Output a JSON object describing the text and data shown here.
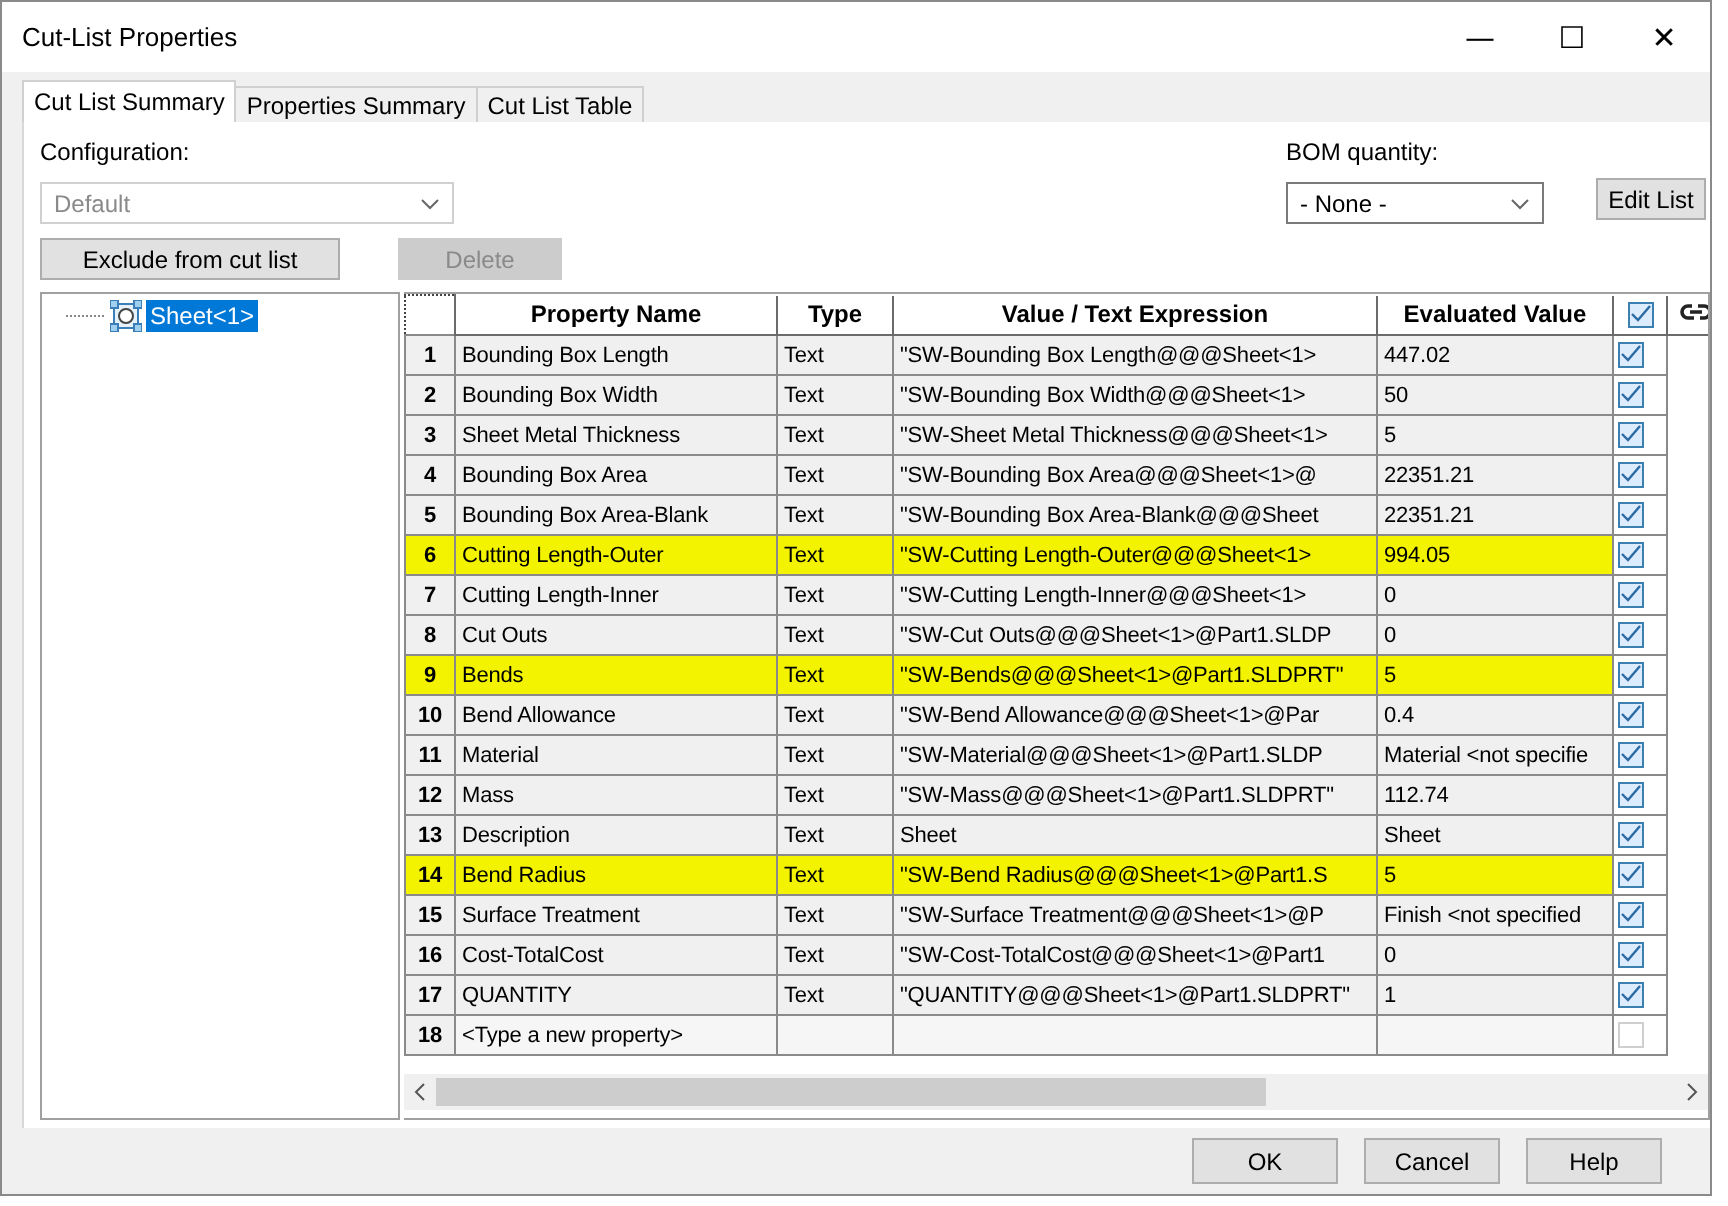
{
  "window": {
    "title": "Cut-List Properties",
    "controls": [
      "—",
      "☐",
      "✕"
    ]
  },
  "tabs": [
    {
      "label": "Cut List Summary",
      "selected": true
    },
    {
      "label": "Properties Summary",
      "selected": false
    },
    {
      "label": "Cut List Table",
      "selected": false
    }
  ],
  "configuration": {
    "label": "Configuration:",
    "value": "Default",
    "disabled": true
  },
  "bom_quantity": {
    "label": "BOM quantity:",
    "value": "- None -"
  },
  "buttons": {
    "exclude": {
      "label": "Exclude from cut list",
      "disabled": false
    },
    "delete": {
      "label": "Delete",
      "disabled": true
    },
    "edit_list": {
      "label": "Edit List",
      "disabled": false
    }
  },
  "tree": {
    "items": [
      {
        "label": "Sheet<1>",
        "selected": true
      }
    ]
  },
  "table": {
    "columns": [
      "Property Name",
      "Type",
      "Value / Text Expression",
      "Evaluated Value"
    ],
    "include_all": true,
    "rows": [
      {
        "number": "1",
        "name": "Bounding Box Length",
        "type": "Text",
        "value": "\"SW-Bounding Box Length@@@Sheet<1>",
        "evaluated": "447.02",
        "included": true,
        "highlighted": false
      },
      {
        "number": "2",
        "name": "Bounding Box Width",
        "type": "Text",
        "value": "\"SW-Bounding Box Width@@@Sheet<1>",
        "evaluated": "50",
        "included": true,
        "highlighted": false
      },
      {
        "number": "3",
        "name": "Sheet Metal Thickness",
        "type": "Text",
        "value": "\"SW-Sheet Metal Thickness@@@Sheet<1>",
        "evaluated": "5",
        "included": true,
        "highlighted": false
      },
      {
        "number": "4",
        "name": "Bounding Box Area",
        "type": "Text",
        "value": "\"SW-Bounding Box Area@@@Sheet<1>@",
        "evaluated": "22351.21",
        "included": true,
        "highlighted": false
      },
      {
        "number": "5",
        "name": "Bounding Box Area-Blank",
        "type": "Text",
        "value": "\"SW-Bounding Box Area-Blank@@@Sheet",
        "evaluated": "22351.21",
        "included": true,
        "highlighted": false
      },
      {
        "number": "6",
        "name": "Cutting Length-Outer",
        "type": "Text",
        "value": "\"SW-Cutting Length-Outer@@@Sheet<1>",
        "evaluated": "994.05",
        "included": true,
        "highlighted": true
      },
      {
        "number": "7",
        "name": "Cutting Length-Inner",
        "type": "Text",
        "value": "\"SW-Cutting Length-Inner@@@Sheet<1>",
        "evaluated": "0",
        "included": true,
        "highlighted": false
      },
      {
        "number": "8",
        "name": "Cut Outs",
        "type": "Text",
        "value": "\"SW-Cut Outs@@@Sheet<1>@Part1.SLDP",
        "evaluated": "0",
        "included": true,
        "highlighted": false
      },
      {
        "number": "9",
        "name": "Bends",
        "type": "Text",
        "value": "\"SW-Bends@@@Sheet<1>@Part1.SLDPRT\"",
        "evaluated": "5",
        "included": true,
        "highlighted": true
      },
      {
        "number": "10",
        "name": "Bend Allowance",
        "type": "Text",
        "value": "\"SW-Bend Allowance@@@Sheet<1>@Par",
        "evaluated": "0.4",
        "included": true,
        "highlighted": false
      },
      {
        "number": "11",
        "name": "Material",
        "type": "Text",
        "value": "\"SW-Material@@@Sheet<1>@Part1.SLDP",
        "evaluated": "Material <not specifie",
        "included": true,
        "highlighted": false
      },
      {
        "number": "12",
        "name": "Mass",
        "type": "Text",
        "value": "\"SW-Mass@@@Sheet<1>@Part1.SLDPRT\"",
        "evaluated": "112.74",
        "included": true,
        "highlighted": false
      },
      {
        "number": "13",
        "name": "Description",
        "type": "Text",
        "value": "Sheet",
        "evaluated": "Sheet",
        "included": true,
        "highlighted": false
      },
      {
        "number": "14",
        "name": "Bend Radius",
        "type": "Text",
        "value": "\"SW-Bend Radius@@@Sheet<1>@Part1.S",
        "evaluated": "5",
        "included": true,
        "highlighted": true
      },
      {
        "number": "15",
        "name": "Surface Treatment",
        "type": "Text",
        "value": "\"SW-Surface Treatment@@@Sheet<1>@P",
        "evaluated": "Finish <not specified",
        "included": true,
        "highlighted": false
      },
      {
        "number": "16",
        "name": "Cost-TotalCost",
        "type": "Text",
        "value": "\"SW-Cost-TotalCost@@@Sheet<1>@Part1",
        "evaluated": "0",
        "included": true,
        "highlighted": false
      },
      {
        "number": "17",
        "name": "QUANTITY",
        "type": "Text",
        "value": "\"QUANTITY@@@Sheet<1>@Part1.SLDPRT\"",
        "evaluated": "1",
        "included": true,
        "highlighted": false
      },
      {
        "number": "18",
        "name": "<Type a new property>",
        "included": false,
        "highlighted": false
      }
    ]
  },
  "footer_buttons": [
    "OK",
    "Cancel",
    "Help"
  ]
}
